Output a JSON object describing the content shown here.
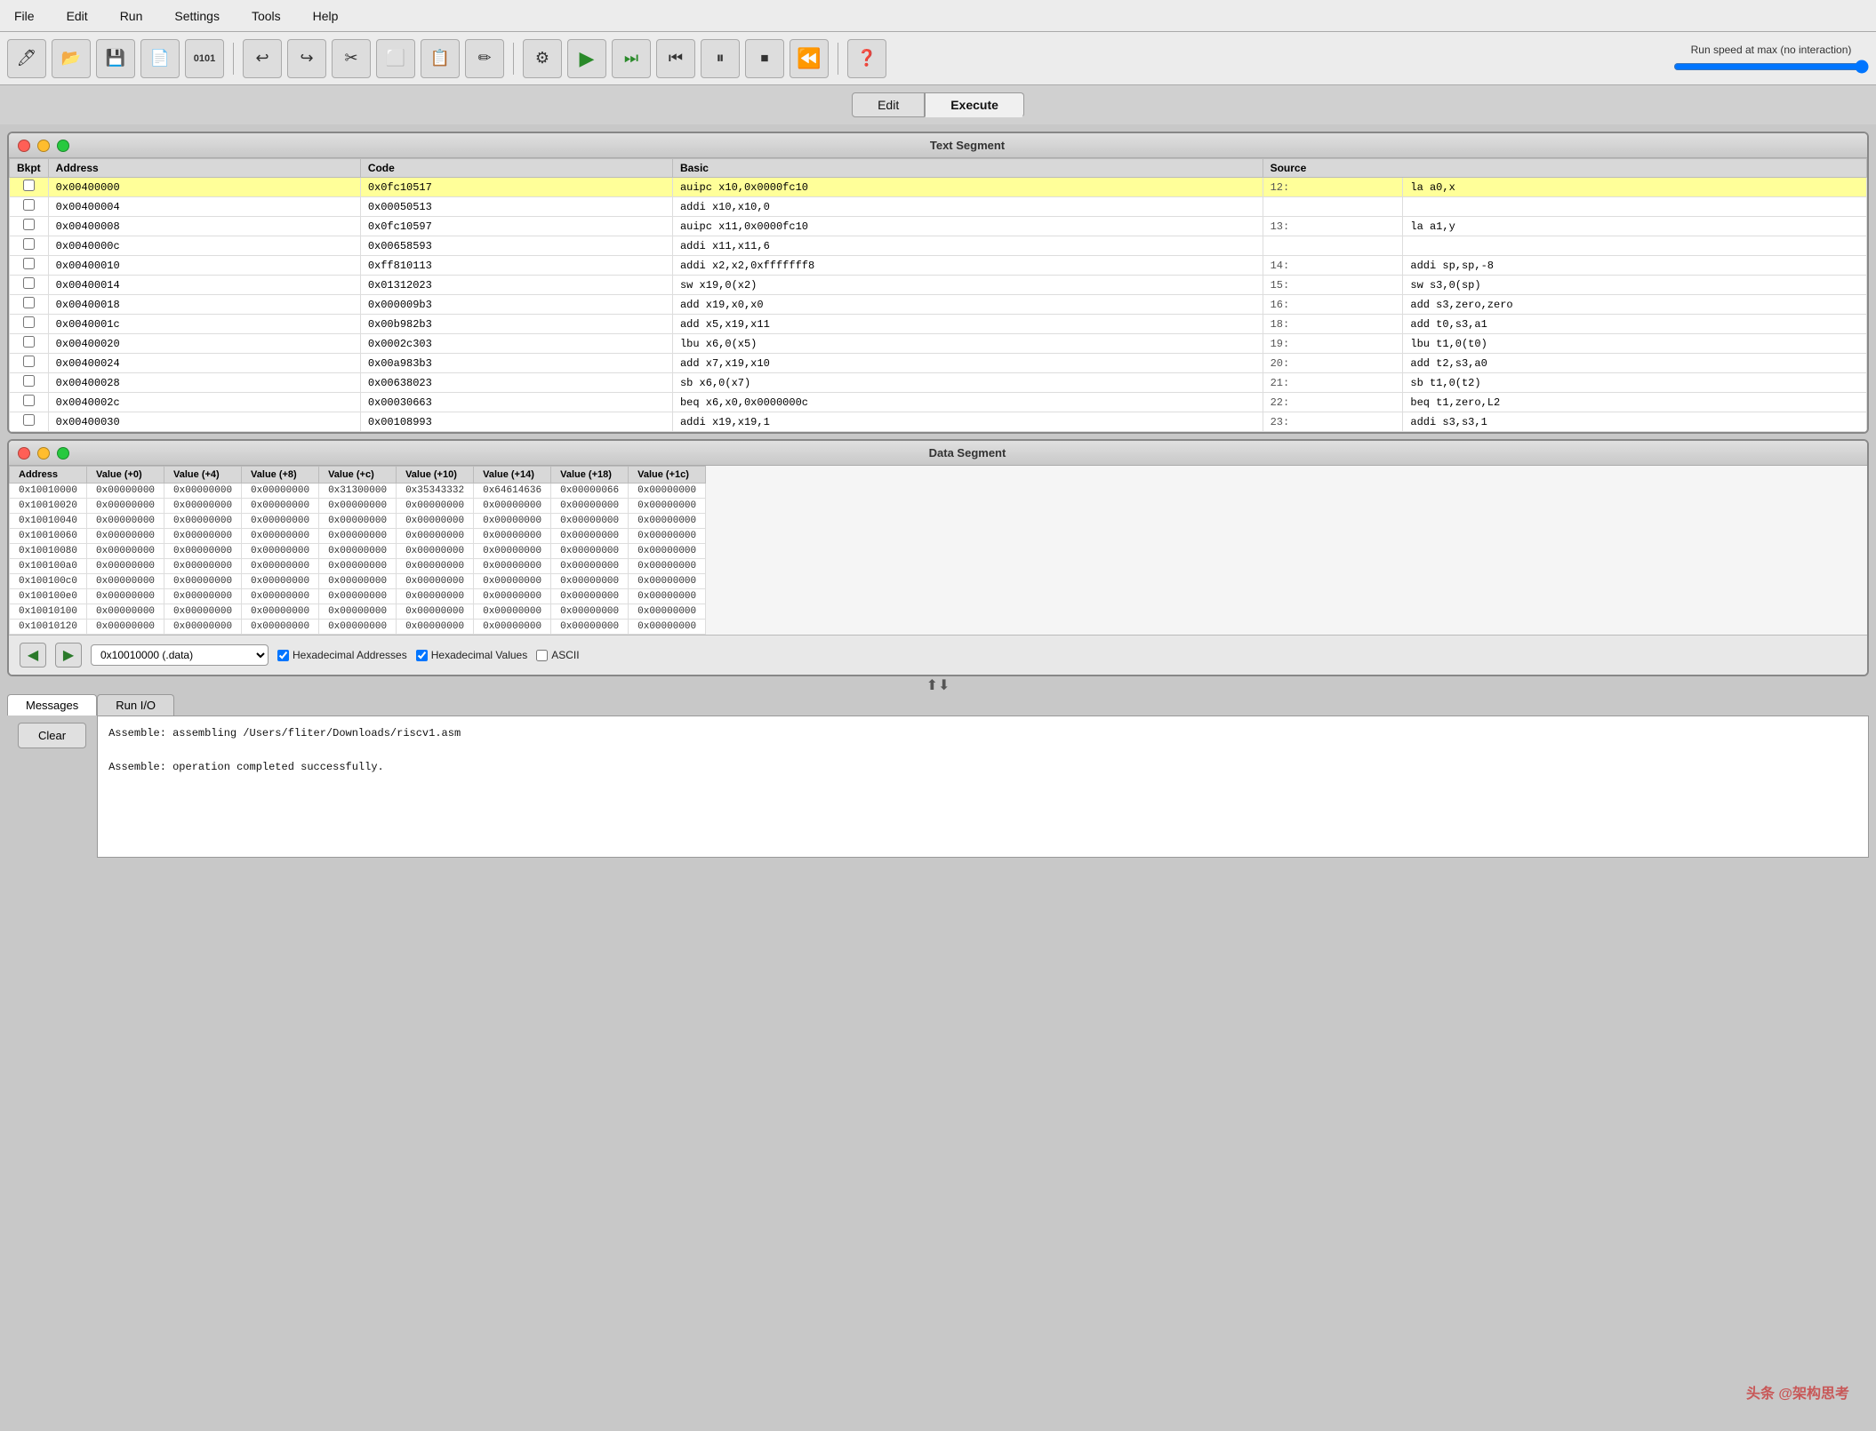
{
  "menubar": {
    "items": [
      "File",
      "Edit",
      "Run",
      "Settings",
      "Tools",
      "Help"
    ]
  },
  "toolbar": {
    "speed_label": "Run speed at max (no interaction)",
    "buttons": [
      {
        "name": "new-btn",
        "icon": "🖊",
        "label": "New"
      },
      {
        "name": "open-btn",
        "icon": "📂",
        "label": "Open"
      },
      {
        "name": "save-btn",
        "icon": "💾",
        "label": "Save"
      },
      {
        "name": "saveas-btn",
        "icon": "📄",
        "label": "Save As"
      },
      {
        "name": "binary-btn",
        "icon": "01",
        "label": "Binary"
      },
      {
        "name": "undo-btn",
        "icon": "↩",
        "label": "Undo"
      },
      {
        "name": "redo-btn",
        "icon": "↪",
        "label": "Redo"
      },
      {
        "name": "cut-btn",
        "icon": "✂",
        "label": "Cut"
      },
      {
        "name": "copy-btn",
        "icon": "📋",
        "label": "Copy"
      },
      {
        "name": "paste-btn",
        "icon": "📌",
        "label": "Paste"
      },
      {
        "name": "edit-btn",
        "icon": "✏",
        "label": "Edit"
      },
      {
        "name": "assemble-btn",
        "icon": "⚙",
        "label": "Assemble"
      },
      {
        "name": "run-btn",
        "icon": "▶",
        "label": "Run"
      },
      {
        "name": "step-btn",
        "icon": "⏭",
        "label": "Step"
      },
      {
        "name": "backstep-btn",
        "icon": "⏮",
        "label": "Back Step"
      },
      {
        "name": "pause-btn",
        "icon": "⏸",
        "label": "Pause"
      },
      {
        "name": "stop-btn",
        "icon": "⏹",
        "label": "Stop"
      },
      {
        "name": "reset-btn",
        "icon": "⏪",
        "label": "Reset"
      },
      {
        "name": "help-btn",
        "icon": "❓",
        "label": "Help"
      }
    ]
  },
  "tabs": {
    "edit_label": "Edit",
    "execute_label": "Execute"
  },
  "text_segment": {
    "title": "Text Segment",
    "headers": [
      "Bkpt",
      "Address",
      "Code",
      "Basic",
      "Source"
    ],
    "rows": [
      {
        "checked": false,
        "address": "0x00400000",
        "code": "0x0fc10517",
        "basic": "auipc x10,0x0000fc10",
        "line": "12:",
        "source": "la a0,x",
        "highlighted": true
      },
      {
        "checked": false,
        "address": "0x00400004",
        "code": "0x00050513",
        "basic": "addi x10,x10,0",
        "line": "",
        "source": "",
        "highlighted": false
      },
      {
        "checked": false,
        "address": "0x00400008",
        "code": "0x0fc10597",
        "basic": "auipc x11,0x0000fc10",
        "line": "13:",
        "source": "la a1,y",
        "highlighted": false
      },
      {
        "checked": false,
        "address": "0x0040000c",
        "code": "0x00658593",
        "basic": "addi x11,x11,6",
        "line": "",
        "source": "",
        "highlighted": false
      },
      {
        "checked": false,
        "address": "0x00400010",
        "code": "0xff810113",
        "basic": "addi x2,x2,0xfffffff8",
        "line": "14:",
        "source": "addi sp,sp,-8",
        "highlighted": false
      },
      {
        "checked": false,
        "address": "0x00400014",
        "code": "0x01312023",
        "basic": "sw x19,0(x2)",
        "line": "15:",
        "source": "sw   s3,0(sp)",
        "highlighted": false
      },
      {
        "checked": false,
        "address": "0x00400018",
        "code": "0x000009b3",
        "basic": "add x19,x0,x0",
        "line": "16:",
        "source": "add  s3,zero,zero",
        "highlighted": false
      },
      {
        "checked": false,
        "address": "0x0040001c",
        "code": "0x00b982b3",
        "basic": "add x5,x19,x11",
        "line": "18:",
        "source": "add  t0,s3,a1",
        "highlighted": false
      },
      {
        "checked": false,
        "address": "0x00400020",
        "code": "0x0002c303",
        "basic": "lbu x6,0(x5)",
        "line": "19:",
        "source": "lbu  t1,0(t0)",
        "highlighted": false
      },
      {
        "checked": false,
        "address": "0x00400024",
        "code": "0x00a983b3",
        "basic": "add x7,x19,x10",
        "line": "20:",
        "source": "add  t2,s3,a0",
        "highlighted": false
      },
      {
        "checked": false,
        "address": "0x00400028",
        "code": "0x00638023",
        "basic": "sb x6,0(x7)",
        "line": "21:",
        "source": "sb   t1,0(t2)",
        "highlighted": false
      },
      {
        "checked": false,
        "address": "0x0040002c",
        "code": "0x00030663",
        "basic": "beq x6,x0,0x0000000c",
        "line": "22:",
        "source": "beq  t1,zero,L2",
        "highlighted": false
      },
      {
        "checked": false,
        "address": "0x00400030",
        "code": "0x00108993",
        "basic": "addi x19,x19,1",
        "line": "23:",
        "source": "addi s3,s3,1",
        "highlighted": false
      }
    ]
  },
  "data_segment": {
    "title": "Data Segment",
    "headers": [
      "Address",
      "Value (+0)",
      "Value (+4)",
      "Value (+8)",
      "Value (+c)",
      "Value (+10)",
      "Value (+14)",
      "Value (+18)",
      "Value (+1c)"
    ],
    "rows": [
      {
        "addr": "0x10010000",
        "v0": "0x00000000",
        "v4": "0x00000000",
        "v8": "0x00000000",
        "vc": "0x31300000",
        "v10": "0x35343332",
        "v14": "0x64614636",
        "v18": "0x00000066",
        "v1c": "0x00000000"
      },
      {
        "addr": "0x10010020",
        "v0": "0x00000000",
        "v4": "0x00000000",
        "v8": "0x00000000",
        "vc": "0x00000000",
        "v10": "0x00000000",
        "v14": "0x00000000",
        "v18": "0x00000000",
        "v1c": "0x00000000"
      },
      {
        "addr": "0x10010040",
        "v0": "0x00000000",
        "v4": "0x00000000",
        "v8": "0x00000000",
        "vc": "0x00000000",
        "v10": "0x00000000",
        "v14": "0x00000000",
        "v18": "0x00000000",
        "v1c": "0x00000000"
      },
      {
        "addr": "0x10010060",
        "v0": "0x00000000",
        "v4": "0x00000000",
        "v8": "0x00000000",
        "vc": "0x00000000",
        "v10": "0x00000000",
        "v14": "0x00000000",
        "v18": "0x00000000",
        "v1c": "0x00000000"
      },
      {
        "addr": "0x10010080",
        "v0": "0x00000000",
        "v4": "0x00000000",
        "v8": "0x00000000",
        "vc": "0x00000000",
        "v10": "0x00000000",
        "v14": "0x00000000",
        "v18": "0x00000000",
        "v1c": "0x00000000"
      },
      {
        "addr": "0x100100a0",
        "v0": "0x00000000",
        "v4": "0x00000000",
        "v8": "0x00000000",
        "vc": "0x00000000",
        "v10": "0x00000000",
        "v14": "0x00000000",
        "v18": "0x00000000",
        "v1c": "0x00000000"
      },
      {
        "addr": "0x100100c0",
        "v0": "0x00000000",
        "v4": "0x00000000",
        "v8": "0x00000000",
        "vc": "0x00000000",
        "v10": "0x00000000",
        "v14": "0x00000000",
        "v18": "0x00000000",
        "v1c": "0x00000000"
      },
      {
        "addr": "0x100100e0",
        "v0": "0x00000000",
        "v4": "0x00000000",
        "v8": "0x00000000",
        "vc": "0x00000000",
        "v10": "0x00000000",
        "v14": "0x00000000",
        "v18": "0x00000000",
        "v1c": "0x00000000"
      },
      {
        "addr": "0x10010100",
        "v0": "0x00000000",
        "v4": "0x00000000",
        "v8": "0x00000000",
        "vc": "0x00000000",
        "v10": "0x00000000",
        "v14": "0x00000000",
        "v18": "0x00000000",
        "v1c": "0x00000000"
      },
      {
        "addr": "0x10010120",
        "v0": "0x00000000",
        "v4": "0x00000000",
        "v8": "0x00000000",
        "vc": "0x00000000",
        "v10": "0x00000000",
        "v14": "0x00000000",
        "v18": "0x00000000",
        "v1c": "0x00000000"
      }
    ],
    "footer": {
      "addr_select_value": "0x10010000 (.data)",
      "hex_addresses_checked": true,
      "hex_values_checked": true,
      "ascii_checked": false,
      "hex_addresses_label": "Hexadecimal Addresses",
      "hex_values_label": "Hexadecimal Values",
      "ascii_label": "ASCII"
    }
  },
  "bottom_tabs": {
    "messages_label": "Messages",
    "run_io_label": "Run I/O"
  },
  "messages": {
    "lines": [
      "Assemble: assembling /Users/fliter/Downloads/riscv1.asm",
      "",
      "Assemble: operation completed successfully."
    ]
  },
  "clear_button": {
    "label": "Clear"
  },
  "watermark": {
    "line1": "头条 @架构思考",
    "line2": ""
  }
}
